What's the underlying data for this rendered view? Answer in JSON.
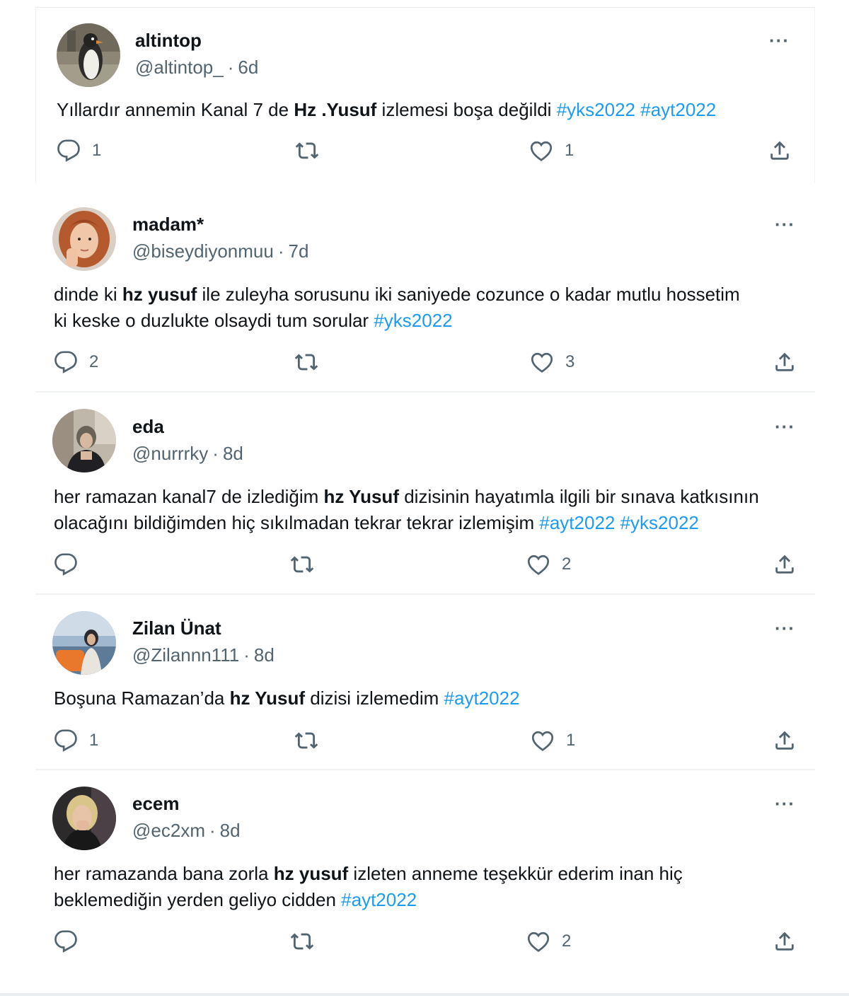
{
  "tweets": [
    {
      "name": "altintop",
      "handle": "@altintop_",
      "time": "6d",
      "more": "···",
      "lines": [
        [
          {
            "t": "Yıllardır annemin Kanal 7 de "
          },
          {
            "t": "Hz .Yusuf",
            "b": true
          },
          {
            "t": " izlemesi boşa değildi "
          },
          {
            "t": "#yks2022",
            "tag": true
          },
          {
            "t": " "
          },
          {
            "t": "#ayt2022",
            "tag": true
          }
        ]
      ],
      "replies": "1",
      "retweets": "",
      "likes": "1"
    },
    {
      "name": "madam*",
      "handle": "@biseydiyonmuu",
      "time": "7d",
      "more": "···",
      "lines": [
        [
          {
            "t": "dinde ki "
          },
          {
            "t": "hz yusuf",
            "b": true
          },
          {
            "t": " ile zuleyha sorusunu iki saniyede cozunce o kadar mutlu hossetim"
          }
        ],
        [
          {
            "t": "ki keske o duzlukte olsaydi tum sorular "
          },
          {
            "t": "#yks2022",
            "tag": true
          }
        ]
      ],
      "replies": "2",
      "retweets": "",
      "likes": "3"
    },
    {
      "name": "eda",
      "handle": "@nurrrky",
      "time": "8d",
      "more": "···",
      "lines": [
        [
          {
            "t": "her ramazan kanal7 de izlediğim "
          },
          {
            "t": "hz Yusuf",
            "b": true
          },
          {
            "t": " dizisinin hayatımla ilgili bir sınava katkısının"
          }
        ],
        [
          {
            "t": "olacağını bildiğimden hiç sıkılmadan tekrar tekrar izlemişim "
          },
          {
            "t": "#ayt2022",
            "tag": true
          },
          {
            "t": " "
          },
          {
            "t": "#yks2022",
            "tag": true
          }
        ]
      ],
      "replies": "",
      "retweets": "",
      "likes": "2"
    },
    {
      "name": "Zilan Ünat",
      "handle": "@Zilannn111",
      "time": "8d",
      "more": "···",
      "lines": [
        [
          {
            "t": "Boşuna Ramazan’da "
          },
          {
            "t": "hz Yusuf",
            "b": true
          },
          {
            "t": " dizisi izlemedim "
          },
          {
            "t": "#ayt2022",
            "tag": true
          }
        ]
      ],
      "replies": "1",
      "retweets": "",
      "likes": "1"
    },
    {
      "name": "ecem",
      "handle": "@ec2xm",
      "time": "8d",
      "more": "···",
      "lines": [
        [
          {
            "t": "her ramazanda bana zorla "
          },
          {
            "t": "hz yusuf",
            "b": true
          },
          {
            "t": " izleten anneme teşekkür ederim inan hiç"
          }
        ],
        [
          {
            "t": "beklemediğin yerden geliyo cidden "
          },
          {
            "t": "#ayt2022",
            "tag": true
          }
        ]
      ],
      "replies": "",
      "retweets": "",
      "likes": "2"
    }
  ],
  "icons": {
    "reply": "reply-bubble-icon",
    "retweet": "retweet-icon",
    "like": "heart-icon",
    "share": "share-upload-icon"
  },
  "colors": {
    "hashtag": "#1d9bf0",
    "secondary_text": "#536471",
    "primary_text": "#0f1419",
    "divider": "#eff3f4"
  }
}
